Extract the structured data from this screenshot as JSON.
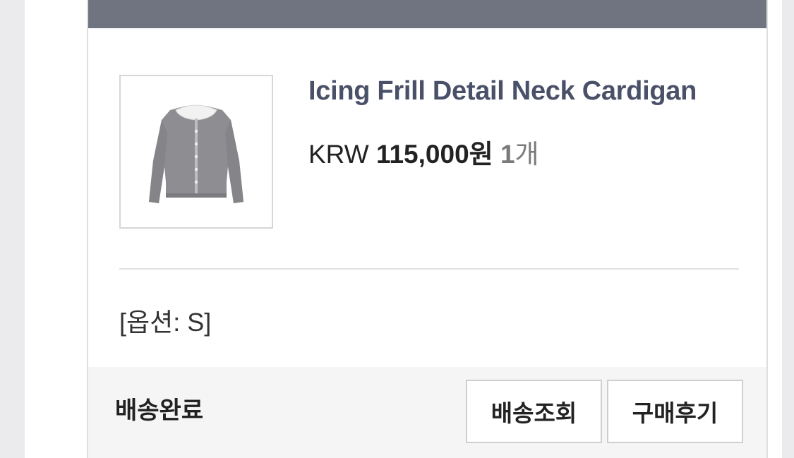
{
  "order_item": {
    "product_name": "Icing Frill Detail Neck Cardigan",
    "price_currency": "KRW",
    "price_amount": "115,000원",
    "quantity": "1",
    "quantity_unit": "개",
    "option_text": "[옵션: S]",
    "thumbnail_icon": "cardigan-image"
  },
  "footer": {
    "status": "배송완료",
    "track_button": "배송조회",
    "review_button": "구매후기"
  },
  "colors": {
    "header_bar": "#6f7480",
    "product_name": "#4a5068",
    "footer_bg": "#f5f5f5"
  }
}
